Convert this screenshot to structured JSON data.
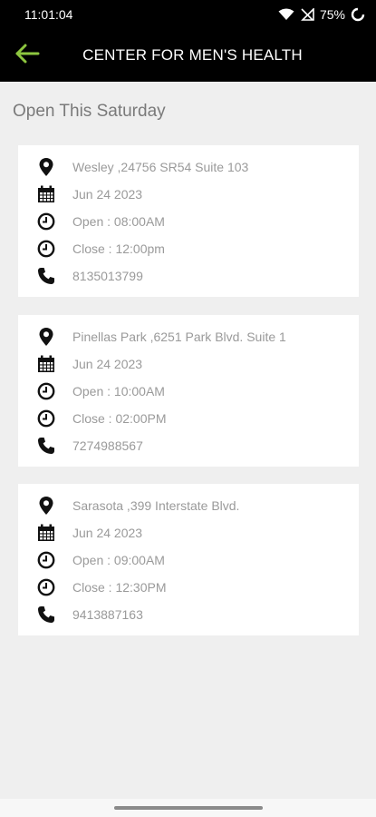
{
  "status_bar": {
    "time": "11:01:04",
    "battery": "75%"
  },
  "header": {
    "title": "CENTER FOR MEN'S HEALTH",
    "accent_color": "#8dc63f"
  },
  "section": {
    "title": "Open This Saturday"
  },
  "locations": [
    {
      "address": "Wesley ,24756 SR54 Suite 103",
      "date": "Jun 24 2023",
      "open": "Open : 08:00AM",
      "close": "Close : 12:00pm",
      "phone": "8135013799"
    },
    {
      "address": "Pinellas Park ,6251 Park Blvd. Suite 1",
      "date": "Jun 24 2023",
      "open": "Open : 10:00AM",
      "close": "Close : 02:00PM",
      "phone": "7274988567"
    },
    {
      "address": "Sarasota ,399 Interstate Blvd.",
      "date": "Jun 24 2023",
      "open": "Open : 09:00AM",
      "close": "Close : 12:30PM",
      "phone": "9413887163"
    }
  ],
  "icons": {
    "location": "map-pin-icon",
    "date": "calendar-icon",
    "open": "clock-icon",
    "close": "clock-icon",
    "phone": "phone-icon"
  }
}
